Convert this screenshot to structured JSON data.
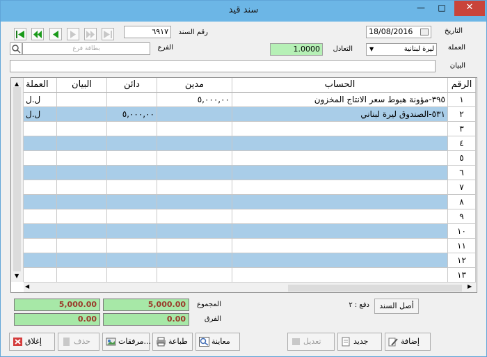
{
  "window": {
    "title": "سند قيد"
  },
  "header": {
    "date_label": "التاريخ",
    "date_value": "18/08/2016",
    "voucher_label": "رقم السند",
    "voucher_value": "٦٩١٧",
    "currency_label": "العملة",
    "currency_value": "ليرة لبنانية",
    "rate_label": "التعادل",
    "rate_value": "1.0000",
    "branch_label": "الفرع",
    "branch_placeholder": "بطاقة فرع",
    "statement_label": "البيان"
  },
  "grid": {
    "columns": [
      "الرقم",
      "الحساب",
      "مدين",
      "دائن",
      "البيان",
      "العملة"
    ],
    "rows": [
      {
        "num": "١",
        "account": "٣٩٥-مؤونة هبوط سعر الانتاج المخزون",
        "debit": "٥,٠٠٠,٠٠",
        "credit": "",
        "note": "",
        "cur": "ل.ل"
      },
      {
        "num": "٢",
        "account": "٥٣١-الصندوق ليرة لبناني",
        "debit": "",
        "credit": "٥,٠٠٠,٠٠",
        "note": "",
        "cur": "ل.ل"
      },
      {
        "num": "٣",
        "account": "",
        "debit": "",
        "credit": "",
        "note": "",
        "cur": ""
      },
      {
        "num": "٤",
        "account": "",
        "debit": "",
        "credit": "",
        "note": "",
        "cur": ""
      },
      {
        "num": "٥",
        "account": "",
        "debit": "",
        "credit": "",
        "note": "",
        "cur": ""
      },
      {
        "num": "٦",
        "account": "",
        "debit": "",
        "credit": "",
        "note": "",
        "cur": ""
      },
      {
        "num": "٧",
        "account": "",
        "debit": "",
        "credit": "",
        "note": "",
        "cur": ""
      },
      {
        "num": "٨",
        "account": "",
        "debit": "",
        "credit": "",
        "note": "",
        "cur": ""
      },
      {
        "num": "٩",
        "account": "",
        "debit": "",
        "credit": "",
        "note": "",
        "cur": ""
      },
      {
        "num": "١٠",
        "account": "",
        "debit": "",
        "credit": "",
        "note": "",
        "cur": ""
      },
      {
        "num": "١١",
        "account": "",
        "debit": "",
        "credit": "",
        "note": "",
        "cur": ""
      },
      {
        "num": "١٢",
        "account": "",
        "debit": "",
        "credit": "",
        "note": "",
        "cur": ""
      },
      {
        "num": "١٣",
        "account": "",
        "debit": "",
        "credit": "",
        "note": "",
        "cur": ""
      }
    ]
  },
  "totals": {
    "sum_label": "المجموع",
    "diff_label": "الفرق",
    "debit_total": "5,000.00",
    "credit_total": "5,000.00",
    "debit_diff": "0.00",
    "credit_diff": "0.00",
    "payment_label": "دفع : ٢",
    "original_button": "أصل السند"
  },
  "toolbar": {
    "close": "إغلاق",
    "delete": "حذف",
    "attachments": "مرفقات...",
    "print": "طباعة",
    "preview": "معاينة",
    "edit": "تعديل",
    "new": "جديد",
    "add": "إضافة"
  },
  "colors": {
    "title_bar": "#6cb6e6",
    "close": "#c9443a",
    "alt_row": "#a9cde8",
    "total": "#a7e8a7",
    "rate": "#b6f0b6"
  }
}
